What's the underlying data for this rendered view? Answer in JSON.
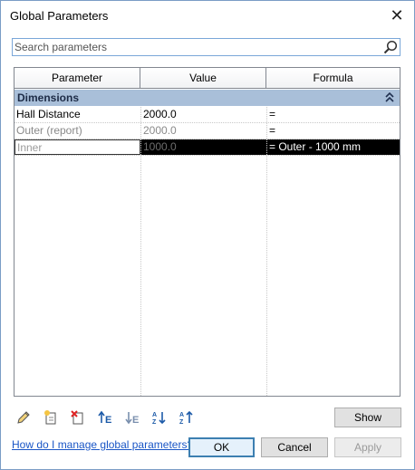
{
  "window": {
    "title": "Global Parameters"
  },
  "search": {
    "placeholder": "Search parameters",
    "value": ""
  },
  "table": {
    "columns": [
      "Parameter",
      "Value",
      "Formula"
    ],
    "group": {
      "label": "Dimensions",
      "collapse_glyph": "⌃"
    },
    "rows": [
      {
        "parameter": "Hall Distance",
        "value": "2000.0",
        "formula": "=",
        "state": "normal"
      },
      {
        "parameter": "Outer (report)",
        "value": "2000.0",
        "formula": "=",
        "state": "reporting"
      },
      {
        "parameter": "Inner",
        "value": "1000.0",
        "formula": "= Outer - 1000 mm",
        "state": "selected"
      }
    ]
  },
  "toolbar": {
    "icons": [
      "edit-parameter-icon",
      "new-parameter-icon",
      "delete-parameter-icon",
      "move-up-icon",
      "move-down-icon",
      "sort-ascending-icon",
      "sort-descending-icon"
    ],
    "show_label": "Show"
  },
  "footer": {
    "help_link": "How do I manage global parameters?",
    "ok_label": "OK",
    "cancel_label": "Cancel",
    "apply_label": "Apply"
  },
  "colors": {
    "group_header": "#a9bfd9",
    "selection": "#000000",
    "link": "#1a56c6",
    "accent_border": "#3c7fb1"
  }
}
